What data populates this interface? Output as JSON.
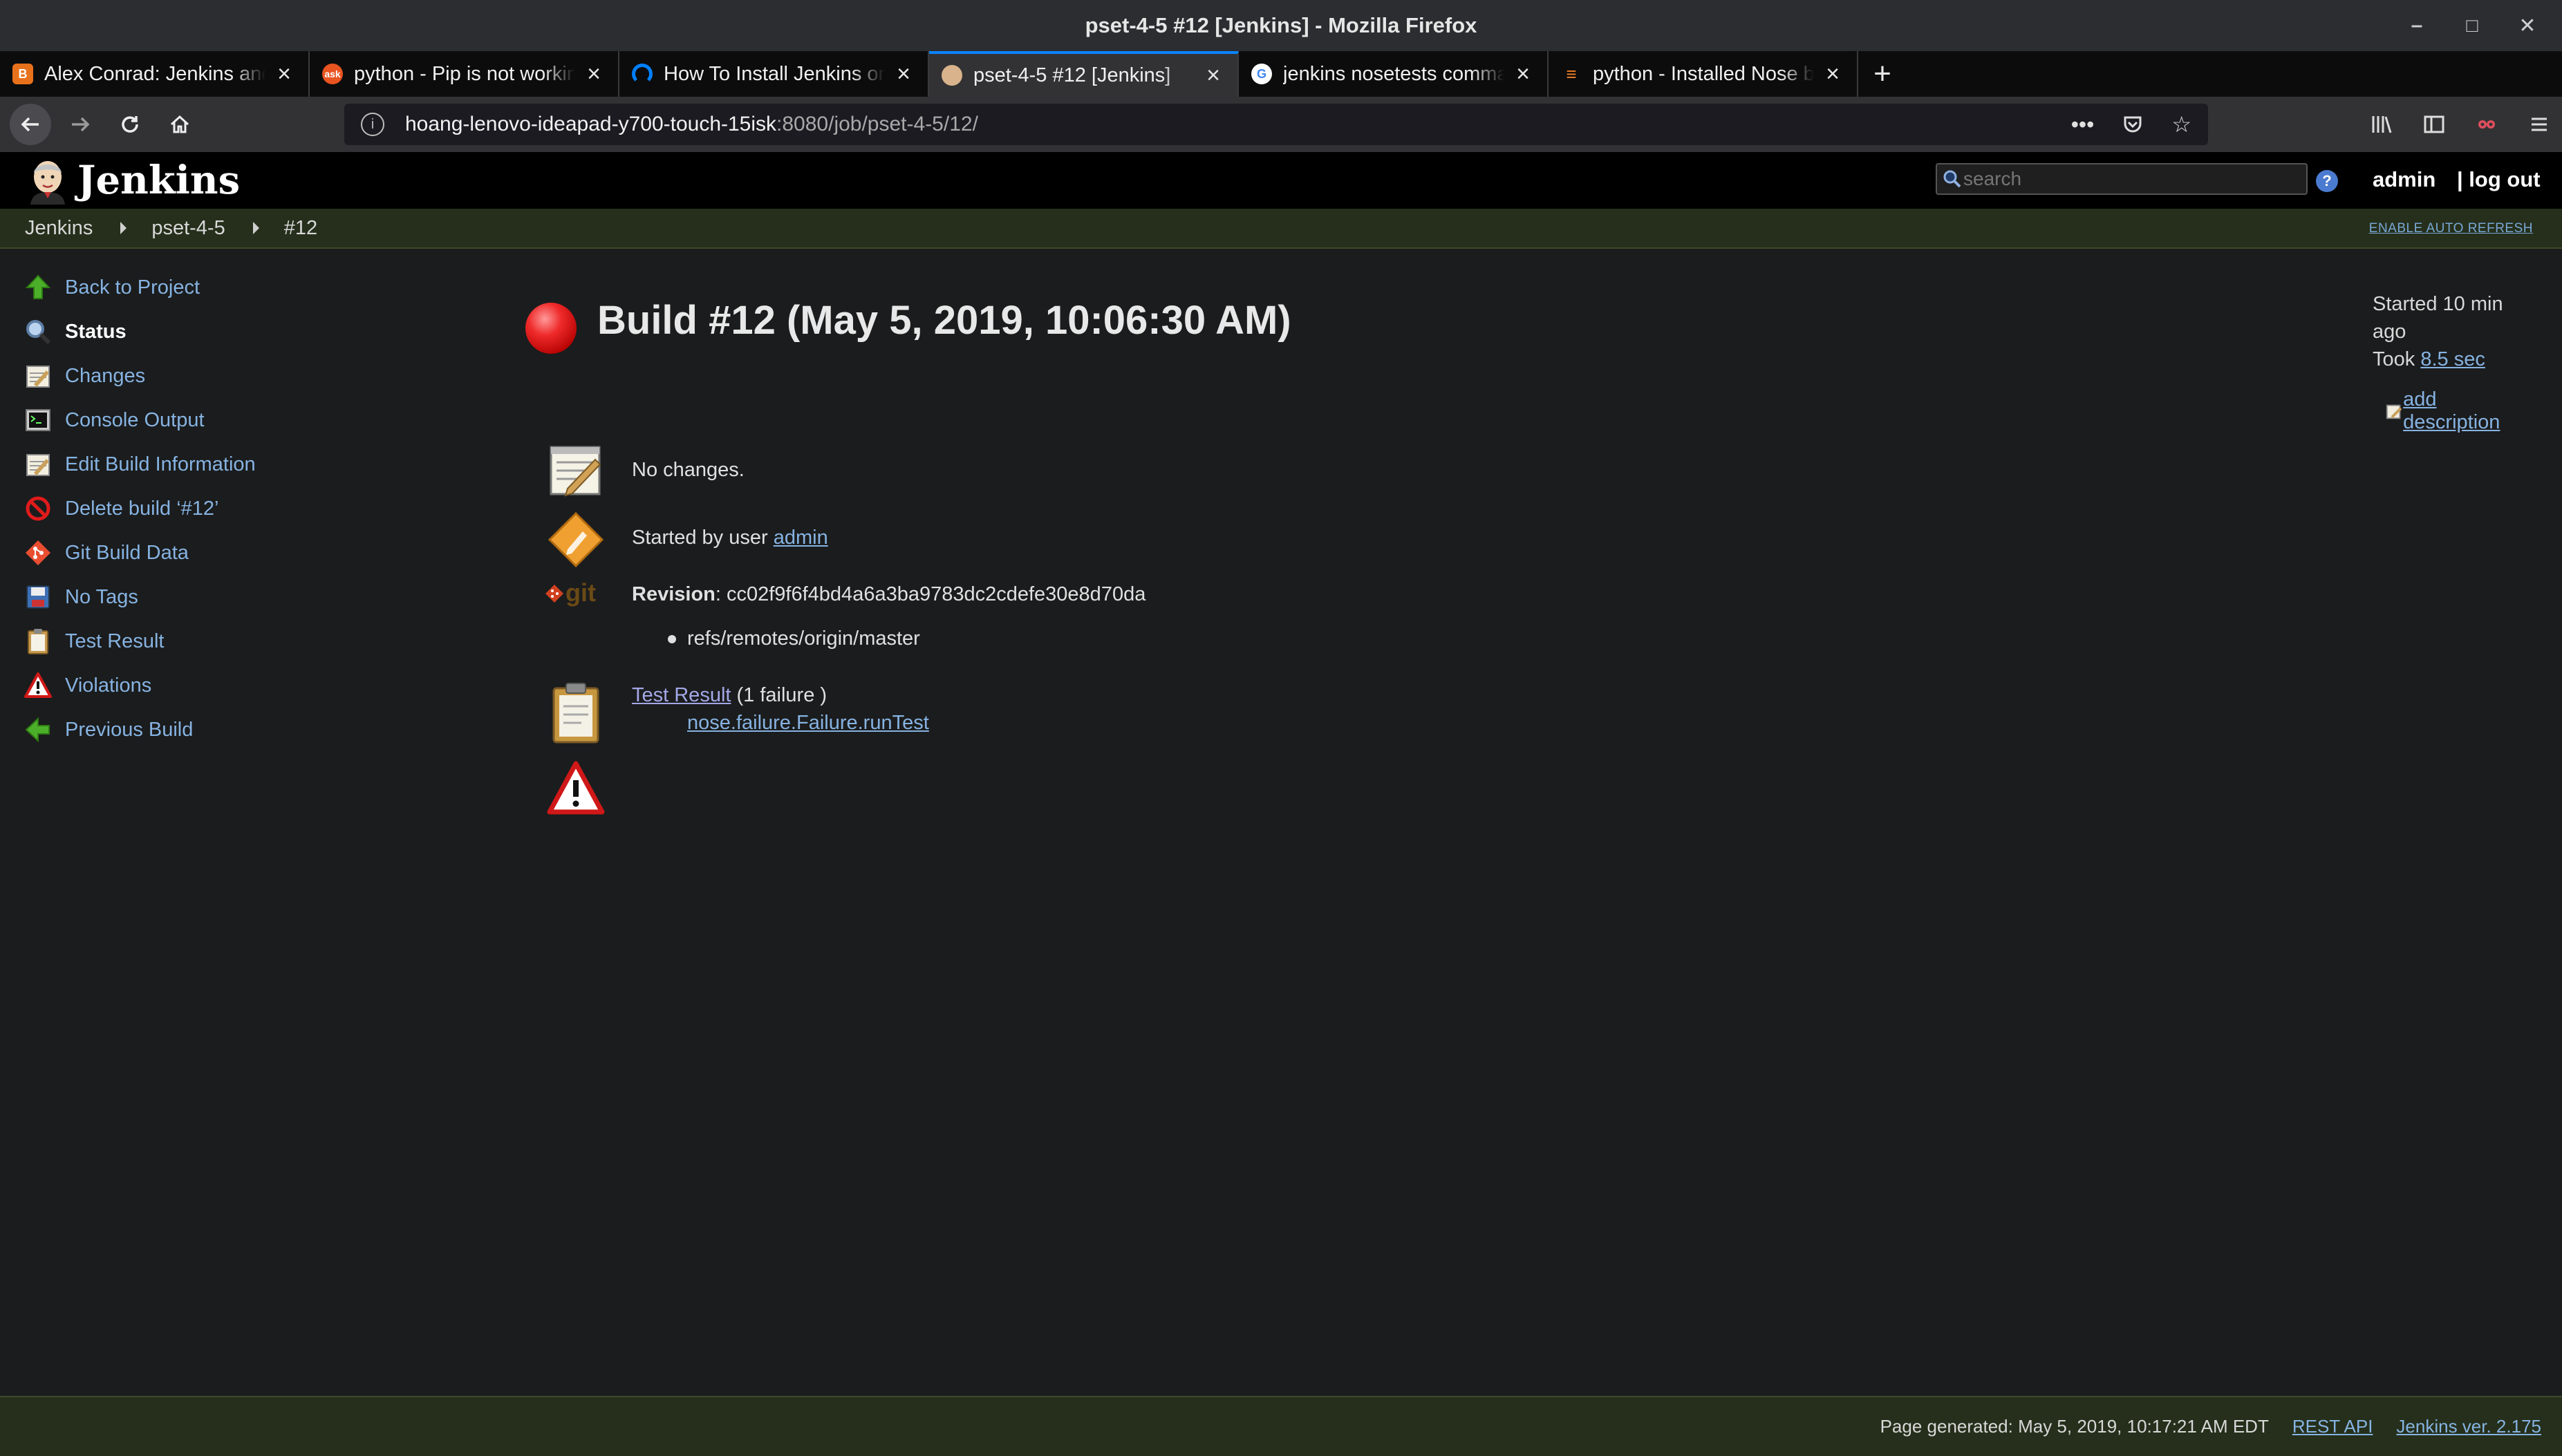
{
  "window": {
    "title": "pset-4-5 #12 [Jenkins] - Mozilla Firefox",
    "controls": {
      "minimize": "–",
      "maximize": "□",
      "close": "✕"
    }
  },
  "tabs": [
    {
      "label": "Alex Conrad: Jenkins and",
      "favicon": "blogger-icon",
      "color": "#e8711b"
    },
    {
      "label": "python - Pip is not workin",
      "favicon": "askubuntu-icon",
      "color": "#e95420"
    },
    {
      "label": "How To Install Jenkins on",
      "favicon": "digitalocean-icon",
      "color": "#0080ff"
    },
    {
      "label": "pset-4-5 #12 [Jenkins]",
      "favicon": "jenkins-icon",
      "color": "#d9b38c",
      "active": true
    },
    {
      "label": "jenkins nosetests comma",
      "favicon": "google-icon",
      "color": "#4285f4"
    },
    {
      "label": "python - Installed Nose b",
      "favicon": "stackoverflow-icon",
      "color": "#f48024"
    }
  ],
  "url": {
    "host": "hoang-lenovo-ideapad-y700-touch-15isk",
    "path": ":8080/job/pset-4-5/12/"
  },
  "jenkins": {
    "title": "Jenkins",
    "search_placeholder": "search",
    "user": "admin",
    "logout": "| log out",
    "breadcrumb": [
      "Jenkins",
      "pset-4-5",
      "#12"
    ],
    "auto_refresh": "ENABLE AUTO REFRESH"
  },
  "sidebar": {
    "items": [
      {
        "label": "Back to Project",
        "icon": "up-arrow-icon"
      },
      {
        "label": "Status",
        "icon": "magnifier-icon",
        "current": true
      },
      {
        "label": "Changes",
        "icon": "notepad-icon"
      },
      {
        "label": "Console Output",
        "icon": "terminal-icon"
      },
      {
        "label": "Edit Build Information",
        "icon": "notepad-icon"
      },
      {
        "label": "Delete build ‘#12’",
        "icon": "no-entry-icon"
      },
      {
        "label": "Git Build Data",
        "icon": "git-icon"
      },
      {
        "label": "No Tags",
        "icon": "save-icon"
      },
      {
        "label": "Test Result",
        "icon": "clipboard-icon"
      },
      {
        "label": "Violations",
        "icon": "warning-icon"
      },
      {
        "label": "Previous Build",
        "icon": "left-arrow-icon"
      }
    ]
  },
  "build": {
    "title": "Build #12 (May 5, 2019, 10:06:30 AM)",
    "status_color": "#e62525",
    "started": "Started 10 min ago",
    "took_label": "Took",
    "took_value": "8.5 sec",
    "add_description": "add description"
  },
  "summary": {
    "changes": "No changes.",
    "started_by_prefix": "Started by user",
    "started_by_user": "admin",
    "revision_label": "Revision",
    "revision_value": ": cc02f9f6f4bd4a6a3ba9783dc2cdefe30e8d70da",
    "branches": [
      "refs/remotes/origin/master"
    ],
    "test_result_link": "Test Result",
    "test_result_suffix": " (1 failure )",
    "failures": [
      "nose.failure.Failure.runTest"
    ],
    "git_logo_text": "git"
  },
  "footer": {
    "generated": "Page generated: May 5, 2019, 10:17:21 AM EDT",
    "rest_api": "REST API",
    "version": "Jenkins ver. 2.175"
  }
}
